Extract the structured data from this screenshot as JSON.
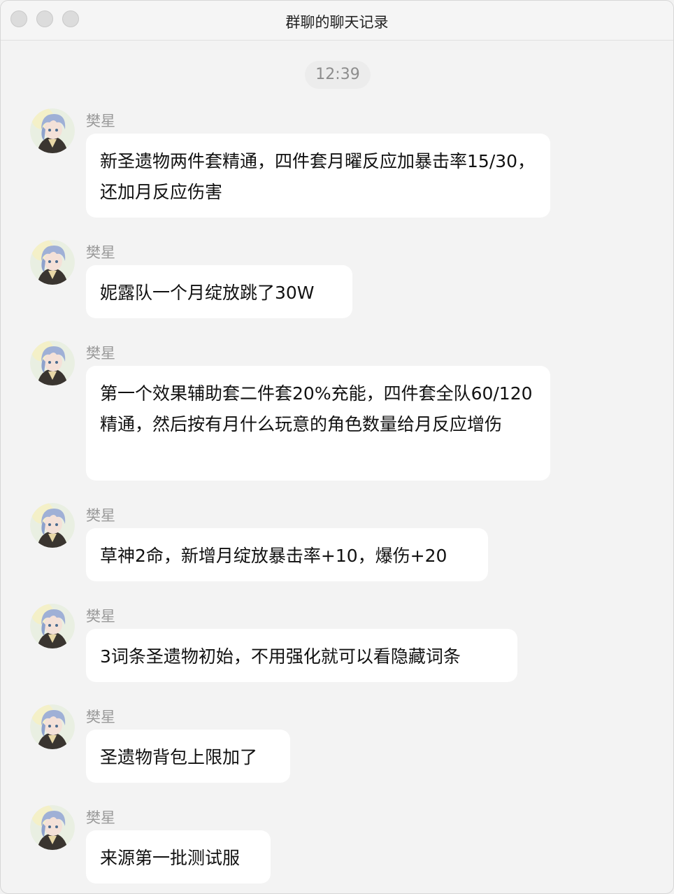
{
  "window": {
    "title": "群聊的聊天记录"
  },
  "chat": {
    "timestamp": "12:39",
    "messages": [
      {
        "sender": "樊星",
        "text": "新圣遗物两件套精通，四件套月曜反应加暴击率15/30，还加月反应伤害"
      },
      {
        "sender": "樊星",
        "text": "妮露队一个月绽放跳了30W"
      },
      {
        "sender": "樊星",
        "text": "第一个效果辅助套二件套20%充能，四件套全队60/120精通，然后按有月什么玩意的角色数量给月反应增伤"
      },
      {
        "sender": "樊星",
        "text": "草神2命，新增月绽放暴击率+10，爆伤+20"
      },
      {
        "sender": "樊星",
        "text": "3词条圣遗物初始，不用强化就可以看隐藏词条"
      },
      {
        "sender": "樊星",
        "text": "圣遗物背包上限加了"
      },
      {
        "sender": "樊星",
        "text": "来源第一批测试服"
      }
    ]
  },
  "colors": {
    "background": "#f3f3f3",
    "bubble": "#ffffff",
    "sender_text": "#9a9a9a",
    "time_pill": "#ececec"
  },
  "icons": {
    "avatar": "anime-avatar-icon"
  }
}
